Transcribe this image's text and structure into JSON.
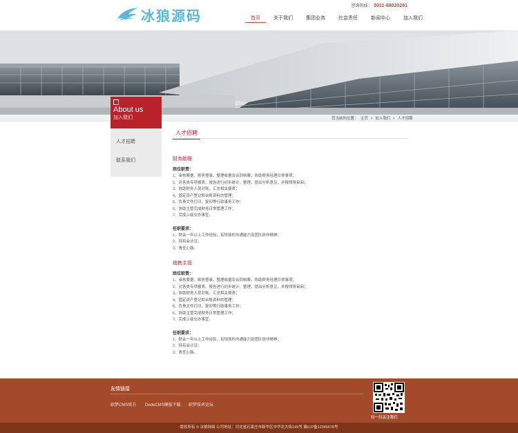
{
  "header": {
    "logo_text": "冰狼源码",
    "hotline_label": "咨询热线：",
    "hotline_number": "0311-68020281"
  },
  "nav": {
    "items": [
      {
        "label": "首页",
        "active": true
      },
      {
        "label": "关于我们",
        "active": false
      },
      {
        "label": "集团业务",
        "active": false
      },
      {
        "label": "社会责任",
        "active": false
      },
      {
        "label": "新闻中心",
        "active": false
      },
      {
        "label": "加入我们",
        "active": false
      }
    ]
  },
  "breadcrumb": {
    "label": "您当前的位置：",
    "parts": [
      "主页",
      ">",
      "加入我们",
      ">",
      "人才招聘"
    ]
  },
  "sidebar": {
    "title_en": "About us",
    "title_cn": "加入我们",
    "items": [
      {
        "label": "人才招聘"
      },
      {
        "label": "联系我们"
      }
    ]
  },
  "main": {
    "title": "人才招聘",
    "jobs": [
      {
        "title": "财务助理",
        "duty_label": "岗位职责：",
        "duties": [
          "1、审核票据，账务登录，整理收据及合同档案，协助财务经理日常事项；",
          "2、对各类专项报表、报告进行初步统计、整理，提出分析意见，并报领导审阅；",
          "3、协助财务人员对账，汇总相关报表；",
          "4、固定资产登记和台账资料的管理；",
          "5、负责文件打印、复印等行政事务工作；",
          "6、协助主管完成财务日常管理工作；",
          "7、完成上级交办事宜。"
        ],
        "req_label": "任职要求：",
        "requirements": [
          "1、财会一年以上工作经验，有较强的沟通能力及团队协作精神；",
          "2、持有会计证；",
          "3、责任心强。"
        ]
      },
      {
        "title": "销售主管",
        "duty_label": "岗位职责：",
        "duties": [
          "1、审核票据，账务登录，整理收据及合同档案，协助财务经理日常事项；",
          "2、对各类专项报表、报告进行初步统计、整理，提出分析意见，并报领导审阅；",
          "3、协助财务人员对账，汇总相关报表；",
          "4、固定资产登记和台账资料的管理；",
          "5、负责文件打印、复印等行政事务工作；",
          "6、协助主管完成财务日常管理工作；",
          "7、完成上级交办事宜。"
        ],
        "req_label": "任职要求：",
        "requirements": [
          "1、财会一年以上工作经验，有较强的沟通能力及团队协作精神；",
          "2、持有会计证；",
          "3、责任心强。"
        ]
      }
    ]
  },
  "footer": {
    "links_title": "友情链接",
    "links": [
      "织梦CMS官方",
      "DedeCMS模板下载",
      "织梦技术论坛"
    ],
    "qr_caption": "扫一扫关注我们",
    "copyright": "版权所有 © 冰狼网络    公司地址：河北省石家庄市新华区中华北大街169号 冀ICP备12345678号"
  },
  "colors": {
    "accent": "#b8232b",
    "logo": "#5bb8d8",
    "footer_bg": "#a34a2b",
    "copyright_bg": "#7e3519"
  }
}
